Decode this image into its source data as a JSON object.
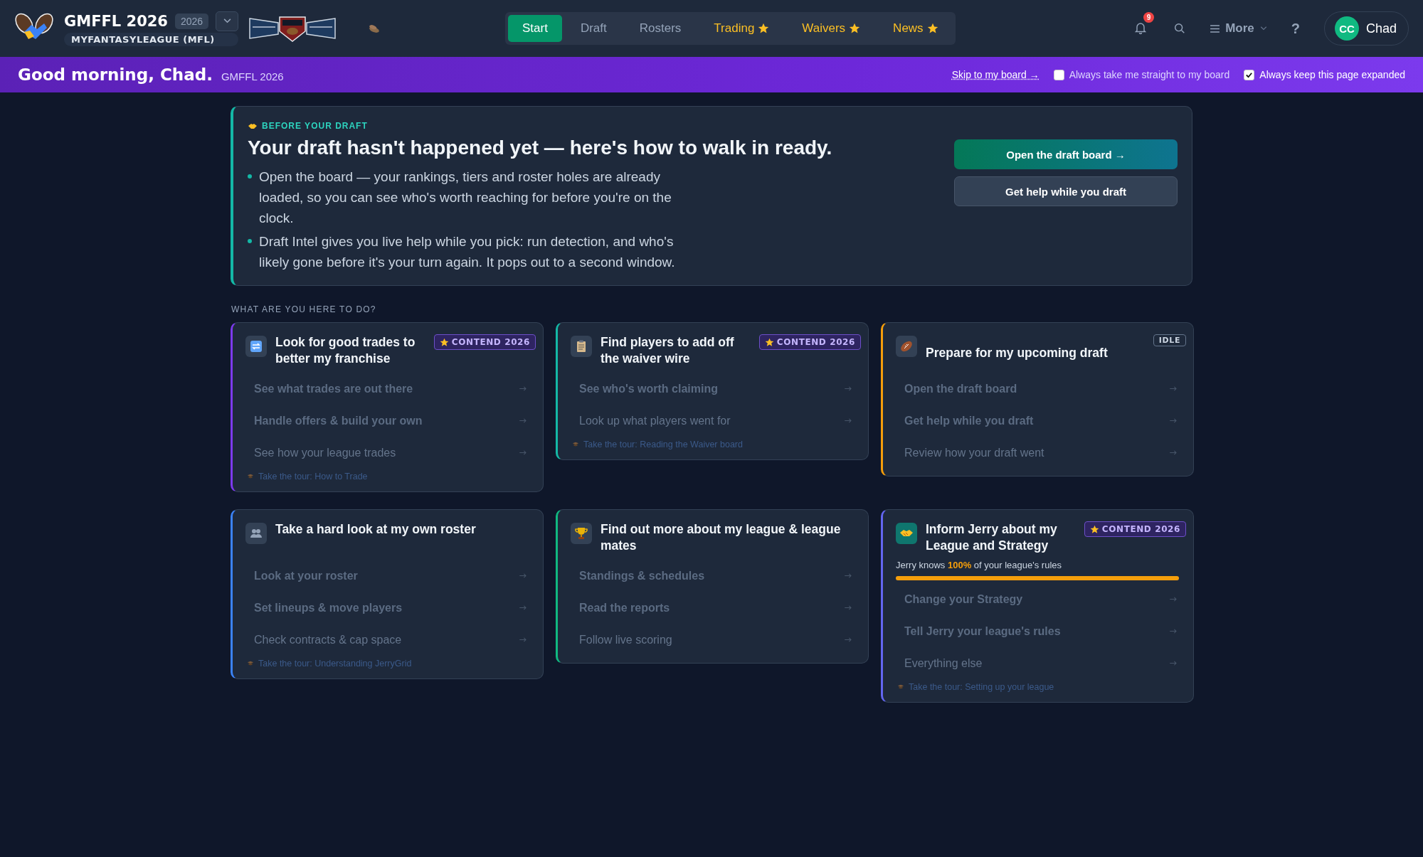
{
  "header": {
    "league_name": "GMFFL 2026",
    "season": "2026",
    "platform": "MYFANTASYLEAGUE (MFL)",
    "nav": [
      {
        "label": "Start",
        "selected": true,
        "starred": false
      },
      {
        "label": "Draft",
        "selected": false,
        "starred": false
      },
      {
        "label": "Rosters",
        "selected": false,
        "starred": false
      },
      {
        "label": "Trading",
        "selected": false,
        "starred": true
      },
      {
        "label": "Waivers",
        "selected": false,
        "starred": true
      },
      {
        "label": "News",
        "selected": false,
        "starred": true
      }
    ],
    "notifications": "9",
    "more": "More",
    "help": "?",
    "user": {
      "initials": "CC",
      "name": "Chad"
    }
  },
  "greeting_bar": {
    "greeting": "Good morning, Chad.",
    "league": "GMFFL 2026",
    "skip_link": "Skip to my board →",
    "options": [
      {
        "label": "Always take me straight to my board",
        "checked": false
      },
      {
        "label": "Always keep this page expanded",
        "checked": true
      }
    ]
  },
  "before_draft": {
    "eyebrow": "BEFORE YOUR DRAFT",
    "title": "Your draft hasn't happened yet — here's how to walk in ready.",
    "bullets": [
      "Open the board — your rankings, tiers and roster holes are already loaded, so you can see who's worth reaching for before you're on the clock.",
      "Draft Intel gives you live help while you pick: run detection, and who's likely gone before it's your turn again. It pops out to a second window."
    ],
    "buttons": [
      {
        "label": "Open the draft board →",
        "kind": "primary"
      },
      {
        "label": "Get help while you draft",
        "kind": "secondary"
      }
    ]
  },
  "section_label": "WHAT ARE YOU HERE TO DO?",
  "cards": [
    {
      "title": "Look for good trades to better my franchise",
      "color": "#7c3aed",
      "badge": {
        "text": "CONTEND 2026",
        "kind": "contend"
      },
      "actions": [
        {
          "label": "See what trades are out there",
          "bold": true
        },
        {
          "label": "Handle offers & build your own",
          "bold": true
        },
        {
          "label": "See how your league trades",
          "bold": false
        }
      ],
      "tour": "Take the tour: How to Trade"
    },
    {
      "title": "Find players to add off the waiver wire",
      "color": "#14b8a6",
      "badge": {
        "text": "CONTEND 2026",
        "kind": "contend"
      },
      "actions": [
        {
          "label": "See who's worth claiming",
          "bold": true
        },
        {
          "label": "Look up what players went for",
          "bold": false
        }
      ],
      "tour": "Take the tour: Reading the Waiver board"
    },
    {
      "title": "Prepare for my upcoming draft",
      "color": "#f59e0b",
      "badge": {
        "text": "IDLE",
        "kind": "idle"
      },
      "actions": [
        {
          "label": "Open the draft board",
          "bold": true
        },
        {
          "label": "Get help while you draft",
          "bold": true
        },
        {
          "label": "Review how your draft went",
          "bold": false
        }
      ]
    },
    {
      "title": "Take a hard look at my own roster",
      "color": "#3b82f6",
      "actions": [
        {
          "label": "Look at your roster",
          "bold": true
        },
        {
          "label": "Set lineups & move players",
          "bold": true
        },
        {
          "label": "Check contracts & cap space",
          "bold": false
        }
      ],
      "tour": "Take the tour: Understanding JerryGrid"
    },
    {
      "title": "Find out more about my league & league mates",
      "color": "#10b981",
      "actions": [
        {
          "label": "Standings & schedules",
          "bold": true
        },
        {
          "label": "Read the reports",
          "bold": true
        },
        {
          "label": "Follow live scoring",
          "bold": false
        }
      ]
    },
    {
      "title": "Inform Jerry about my League and Strategy",
      "color": "#6366f1",
      "badge": {
        "text": "CONTEND 2026",
        "kind": "contend"
      },
      "progress": {
        "text": "Jerry knows **100%** of your league's rules",
        "level": 1
      },
      "actions": [
        {
          "label": "Change your Strategy",
          "bold": true
        },
        {
          "label": "Tell Jerry your league's rules",
          "bold": true
        },
        {
          "label": "Everything else",
          "bold": false
        }
      ],
      "tour": "Take the tour: Setting up your league"
    }
  ]
}
